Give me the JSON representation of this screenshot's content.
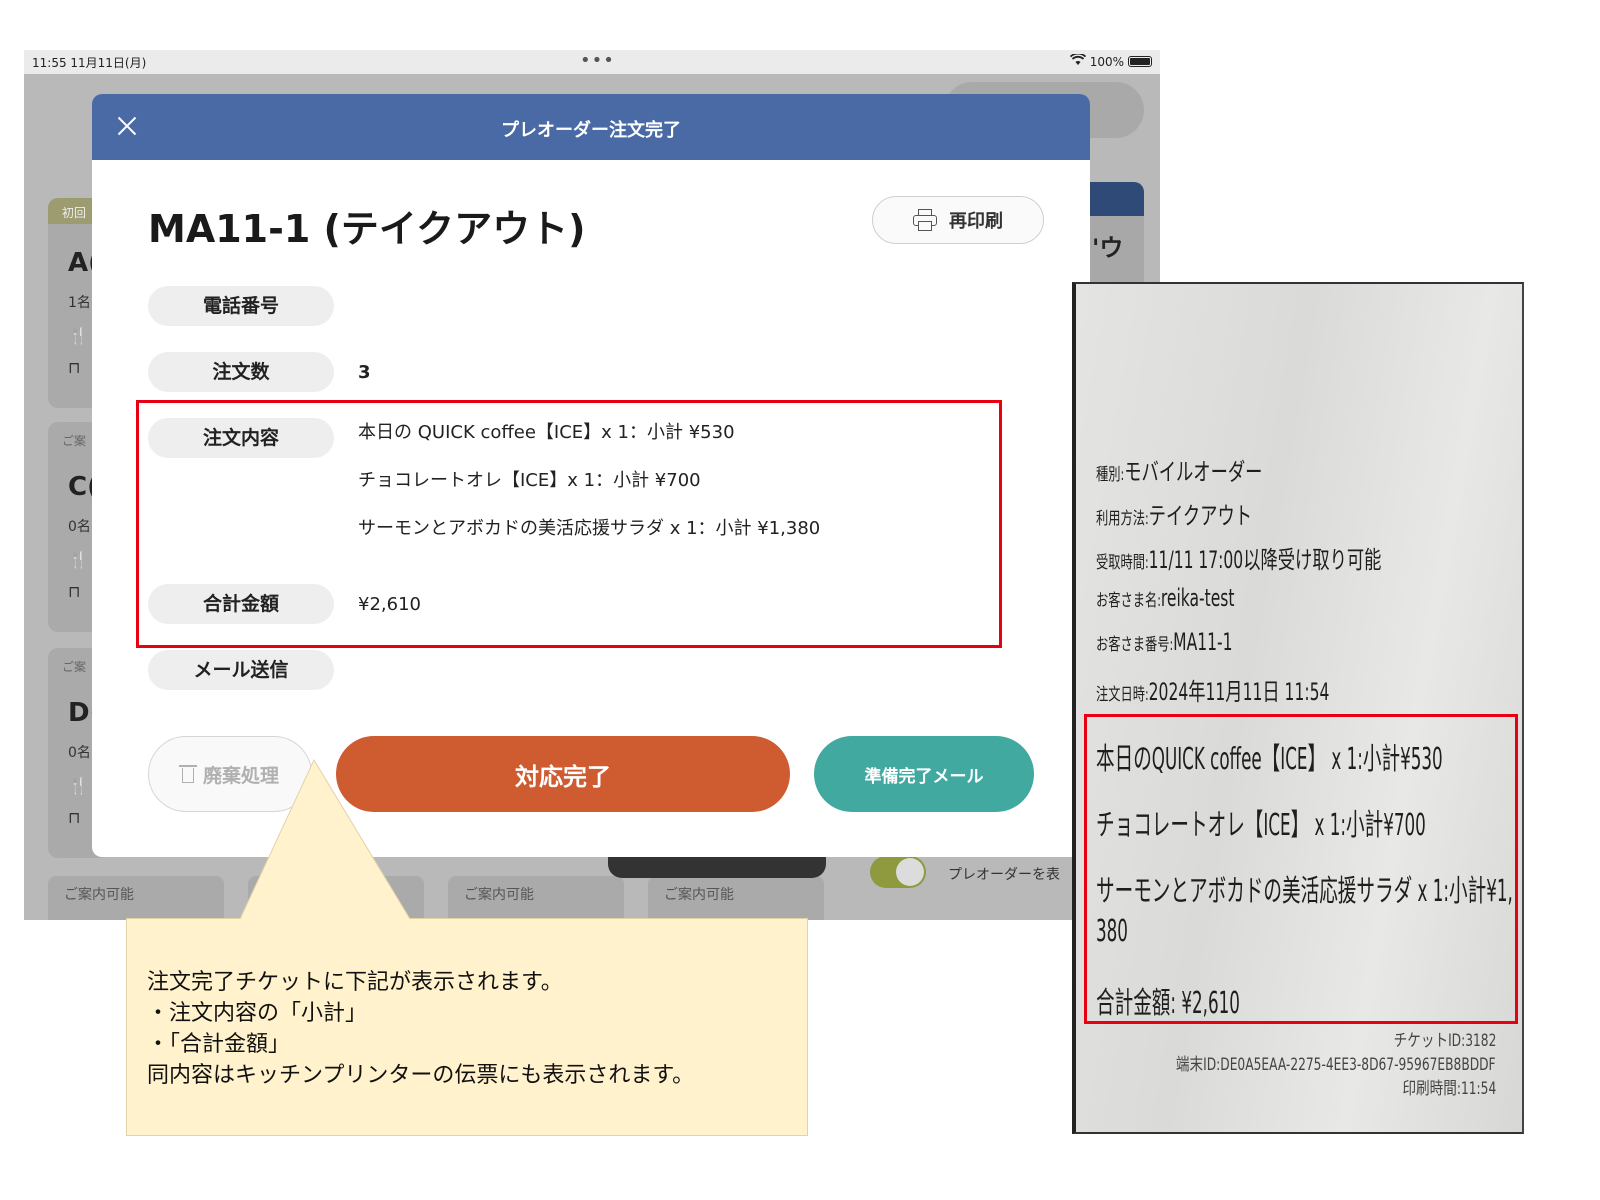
{
  "status_bar": {
    "time": "11:55  11月11日(月)",
    "dots": "•••",
    "battery": "100%"
  },
  "background_app": {
    "cards": [
      {
        "tag": "初回",
        "big": "A(",
        "small": "1名"
      },
      {
        "tag": "ご案",
        "big": "C(",
        "small": "0名"
      },
      {
        "tag": "ご案",
        "big": "D(",
        "small": "0名"
      }
    ],
    "right_card_text": "'ウ",
    "bottom_tabs": [
      "ご案内可能",
      "ご案内可能",
      "ご案内可能"
    ],
    "toggle_label": "プレオーダーを表"
  },
  "modal": {
    "header_title": "プレオーダー注文完了",
    "order_title": "MA11-1 (テイクアウト)",
    "reprint_label": "再印刷",
    "fields": {
      "phone_label": "電話番号",
      "phone_value": "",
      "count_label": "注文数",
      "count_value": "3",
      "items_label": "注文内容",
      "items": [
        "本日の QUICK coffee【ICE】x 1：小計 ¥530",
        "チョコレートオレ【ICE】x 1：小計 ¥700",
        "サーモンとアボカドの美活応援サラダ x 1：小計 ¥1,380"
      ],
      "total_label": "合計金額",
      "total_value": "¥2,610",
      "mail_label": "メール送信"
    },
    "buttons": {
      "discard": "廃棄処理",
      "complete": "対応完了",
      "ready_mail": "準備完了メール"
    }
  },
  "callout": {
    "lines": [
      "注文完了チケットに下記が表示されます。",
      "・注文内容の「小計」",
      "・「合計金額」",
      "同内容はキッチンプリンターの伝票にも表示されます。"
    ]
  },
  "receipt": {
    "info": [
      {
        "key": "種別:",
        "value": "モバイルオーダー"
      },
      {
        "key": "利用方法:",
        "value": "テイクアウト"
      },
      {
        "key": "受取時間:",
        "value": "11/11 17:00以降受け取り可能"
      },
      {
        "key": "お客さま名:",
        "value": "reika-test"
      },
      {
        "key": "お客さま番号:",
        "value": "MA11-1"
      },
      {
        "key": "注文日時:",
        "value": "2024年11月11日 11:54"
      }
    ],
    "items": [
      "本日のQUICK coffee【ICE】 x 1:小計¥530",
      "チョコレートオレ【ICE】 x 1:小計¥700",
      "サーモンとアボカドの美活応援サラダ x 1:小計¥1,",
      "380"
    ],
    "total": "合計金額: ¥2,610",
    "ticket_id": "チケットID:3182",
    "terminal_id": "端末ID:DE0A5EAA-2275-4EE3-8D67-95967EB8BDDF",
    "print_time": "印刷時間:11:54"
  },
  "colors": {
    "header_blue": "#4a6aa5",
    "complete_orange": "#cf5b31",
    "ready_teal": "#42a9a0",
    "highlight_red": "#e60012",
    "callout_yellow": "#fff2cc"
  }
}
